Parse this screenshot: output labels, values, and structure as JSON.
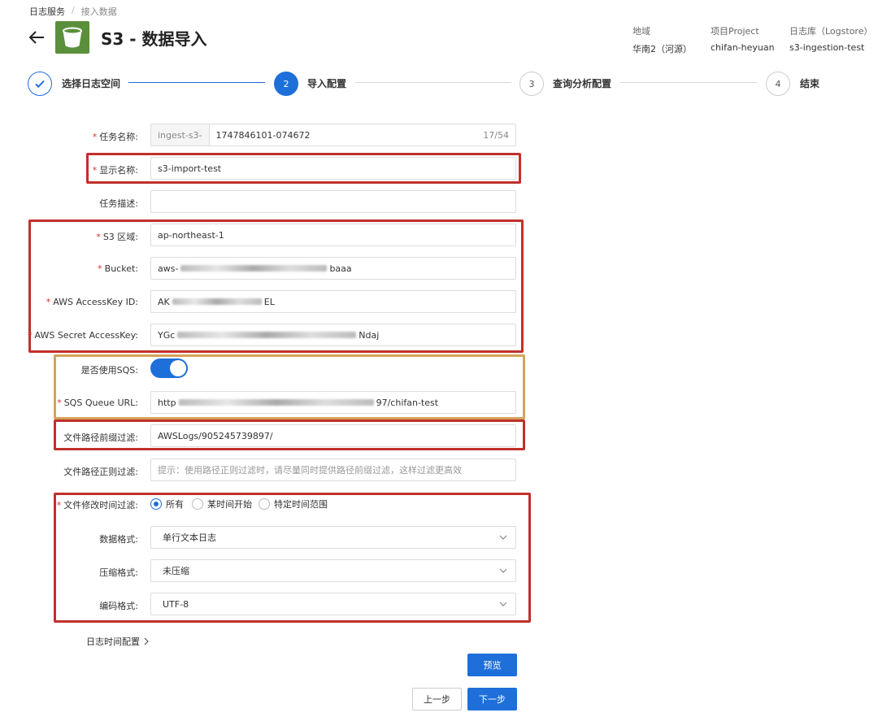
{
  "breadcrumb": {
    "root": "日志服务",
    "separator": "/",
    "current": "接入数据"
  },
  "page": {
    "title": "S3 - 数据导入"
  },
  "meta": {
    "region_label": "地域",
    "region_value": "华南2（河源）",
    "project_label": "项目Project",
    "project_value": "chifan-heyuan",
    "logstore_label": "日志库（Logstore）",
    "logstore_value": "s3-ingestion-test"
  },
  "steps": [
    {
      "number": "1",
      "label": "选择日志空间",
      "state": "done"
    },
    {
      "number": "2",
      "label": "导入配置",
      "state": "active"
    },
    {
      "number": "3",
      "label": "查询分析配置",
      "state": "pending"
    },
    {
      "number": "4",
      "label": "结束",
      "state": "pending"
    }
  ],
  "form": {
    "task_name": {
      "label": "任务名称:",
      "prefix": "ingest-s3-",
      "value": "1747846101-074672",
      "count": "17/54"
    },
    "display_name": {
      "label": "显示名称:",
      "value": "s3-import-test"
    },
    "task_desc": {
      "label": "任务描述:",
      "value": ""
    },
    "s3_region": {
      "label": "S3 区域:",
      "value": "ap-northeast-1"
    },
    "bucket": {
      "label": "Bucket:",
      "value_start": "aws-",
      "value_end": "baaa"
    },
    "access_key_id": {
      "label": "AWS AccessKey ID:",
      "value_start": "AK",
      "value_end": "EL"
    },
    "secret_key": {
      "label": "AWS Secret AccessKey:",
      "value_start": "YGc",
      "value_end": "Ndaj"
    },
    "use_sqs": {
      "label": "是否使用SQS:",
      "enabled": true
    },
    "sqs_url": {
      "label": "SQS Queue URL:",
      "value_start": "http",
      "value_end": "97/chifan-test"
    },
    "path_prefix": {
      "label": "文件路径前缀过滤:",
      "value": "AWSLogs/905245739897/"
    },
    "path_regex": {
      "label": "文件路径正则过滤:",
      "placeholder": "提示：使用路径正则过滤时，请尽量同时提供路径前缀过滤，这样过滤更高效"
    },
    "time_filter": {
      "label": "文件修改时间过滤:",
      "options": [
        "所有",
        "某时间开始",
        "特定时间范围"
      ],
      "selected": "所有"
    },
    "data_format": {
      "label": "数据格式:",
      "value": "单行文本日志"
    },
    "compression": {
      "label": "压缩格式:",
      "value": "未压缩"
    },
    "encoding": {
      "label": "编码格式:",
      "value": "UTF-8"
    },
    "log_time_config": "日志时间配置"
  },
  "buttons": {
    "preview": "预览",
    "prev": "上一步",
    "next": "下一步"
  },
  "colors": {
    "accent": "#1e6fd9",
    "highlight_red": "#c0302a",
    "highlight_gold": "#d4a45a",
    "required": "#d93026"
  }
}
